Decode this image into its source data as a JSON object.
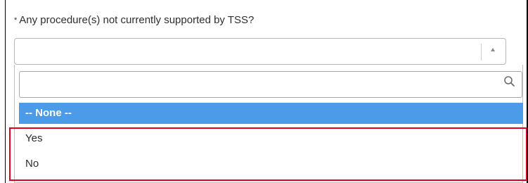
{
  "field": {
    "required_marker": "*",
    "question": "Any procedure(s) not currently supported by TSS?",
    "current_value": ""
  },
  "search": {
    "value": "",
    "placeholder": "",
    "icon": "search-icon"
  },
  "options": [
    {
      "label": "-- None --",
      "selected": true
    },
    {
      "label": "Yes",
      "selected": false
    },
    {
      "label": "No",
      "selected": false
    }
  ],
  "colors": {
    "selected_bg": "#4c9be8",
    "highlight_border": "#e0001b"
  }
}
